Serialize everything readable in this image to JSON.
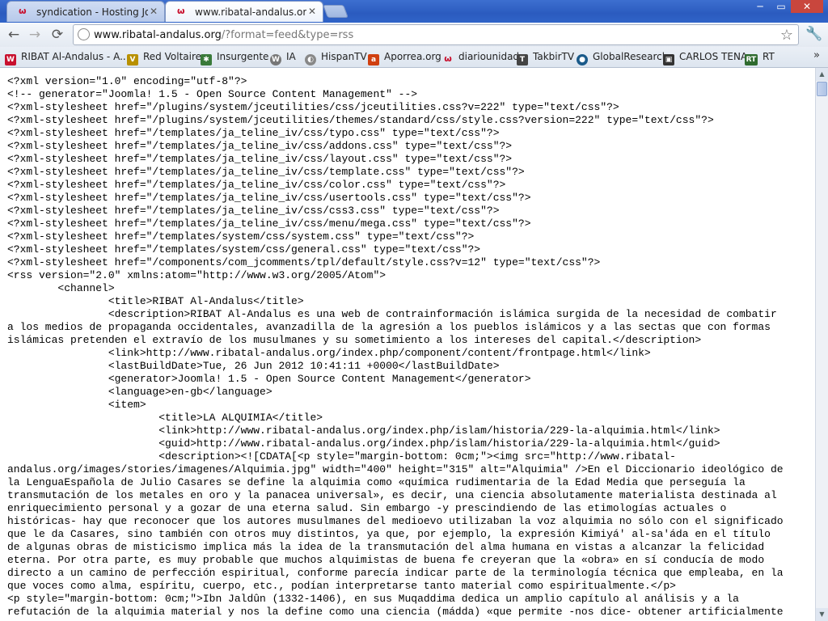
{
  "tabs": [
    {
      "label": "syndication - Hosting Joomla",
      "active": false
    },
    {
      "label": "www.ribatal-andalus.org/?forr",
      "active": true
    }
  ],
  "window_controls": {
    "minimize": "─",
    "maximize": "▭",
    "close": "✕"
  },
  "toolbar": {
    "back": "←",
    "forward": "→",
    "reload": "⟳"
  },
  "omnibox": {
    "host": "www.ribatal-andalus.org",
    "rest": "/?format=feed&type=rss"
  },
  "bookmarks": [
    {
      "label": "RIBAT Al-Andalus - A...",
      "icon": "ribat-icon",
      "color": "#c8102e"
    },
    {
      "label": "Red Voltaire",
      "icon": "voltaire-icon",
      "color": "#b89000"
    },
    {
      "label": "Insurgente",
      "icon": "insurgente-icon",
      "color": "#3a7a3a"
    },
    {
      "label": "IA",
      "icon": "wordpress-icon",
      "color": "#777777"
    },
    {
      "label": "HispanTV",
      "icon": "hispantv-icon",
      "color": "#888888"
    },
    {
      "label": "Aporrea.org",
      "icon": "aporrea-icon",
      "color": "#d04010"
    },
    {
      "label": "diariounidad",
      "icon": "diariounidad-icon",
      "color": "#c8102e"
    },
    {
      "label": "TakbirTV",
      "icon": "takbirtv-icon",
      "color": "#444444"
    },
    {
      "label": "GlobalResearch",
      "icon": "globalresearch-icon",
      "color": "#1a5a8a"
    },
    {
      "label": "CARLOS TENA",
      "icon": "carlostena-icon",
      "color": "#333333"
    },
    {
      "label": "RT",
      "icon": "rt-icon",
      "color": "#2f6b2f"
    }
  ],
  "bookmarks_more": "»",
  "content_lines": [
    "<?xml version=\"1.0\" encoding=\"utf-8\"?>",
    "<!-- generator=\"Joomla! 1.5 - Open Source Content Management\" -->",
    "<?xml-stylesheet href=\"/plugins/system/jceutilities/css/jceutilities.css?v=222\" type=\"text/css\"?>",
    "<?xml-stylesheet href=\"/plugins/system/jceutilities/themes/standard/css/style.css?version=222\" type=\"text/css\"?>",
    "<?xml-stylesheet href=\"/templates/ja_teline_iv/css/typo.css\" type=\"text/css\"?>",
    "<?xml-stylesheet href=\"/templates/ja_teline_iv/css/addons.css\" type=\"text/css\"?>",
    "<?xml-stylesheet href=\"/templates/ja_teline_iv/css/layout.css\" type=\"text/css\"?>",
    "<?xml-stylesheet href=\"/templates/ja_teline_iv/css/template.css\" type=\"text/css\"?>",
    "<?xml-stylesheet href=\"/templates/ja_teline_iv/css/color.css\" type=\"text/css\"?>",
    "<?xml-stylesheet href=\"/templates/ja_teline_iv/css/usertools.css\" type=\"text/css\"?>",
    "<?xml-stylesheet href=\"/templates/ja_teline_iv/css/css3.css\" type=\"text/css\"?>",
    "<?xml-stylesheet href=\"/templates/ja_teline_iv/css/menu/mega.css\" type=\"text/css\"?>",
    "<?xml-stylesheet href=\"/templates/system/css/system.css\" type=\"text/css\"?>",
    "<?xml-stylesheet href=\"/templates/system/css/general.css\" type=\"text/css\"?>",
    "<?xml-stylesheet href=\"/components/com_jcomments/tpl/default/style.css?v=12\" type=\"text/css\"?>",
    "<rss version=\"2.0\" xmlns:atom=\"http://www.w3.org/2005/Atom\">",
    "        <channel>",
    "                <title>RIBAT Al-Andalus</title>",
    "                <description>RIBAT Al-Andalus es una web de contrainformación islámica surgida de la necesidad de combatir",
    "a los medios de propaganda occidentales, avanzadilla de la agresión a los pueblos islámicos y a las sectas que con formas",
    "islámicas pretenden el extravío de los musulmanes y su sometimiento a los intereses del capital.</description>",
    "                <link>http://www.ribatal-andalus.org/index.php/component/content/frontpage.html</link>",
    "                <lastBuildDate>Tue, 26 Jun 2012 10:41:11 +0000</lastBuildDate>",
    "                <generator>Joomla! 1.5 - Open Source Content Management</generator>",
    "                <language>en-gb</language>",
    "                <item>",
    "                        <title>LA ALQUIMIA</title>",
    "                        <link>http://www.ribatal-andalus.org/index.php/islam/historia/229-la-alquimia.html</link>",
    "                        <guid>http://www.ribatal-andalus.org/index.php/islam/historia/229-la-alquimia.html</guid>",
    "                        <description><![CDATA[<p style=\"margin-bottom: 0cm;\"><img src=\"http://www.ribatal-",
    "andalus.org/images/stories/imagenes/Alquimia.jpg\" width=\"400\" height=\"315\" alt=\"Alquimia\" />En el Diccionario ideológico de",
    "la LenguaEspañola de Julio Casares se define la alquimia como «química rudimentaria de la Edad Media que perseguía la",
    "transmutación de los metales en oro y la panacea universal», es decir, una ciencia absolutamente materialista destinada al",
    "enriquecimiento personal y a gozar de una eterna salud. Sin embargo -y prescindiendo de las etimologías actuales o",
    "históricas- hay que reconocer que los autores musulmanes del medioevo utilizaban la voz alquimia no sólo con el significado",
    "que le da Casares, sino también con otros muy distintos, ya que, por ejemplo, la expresión Kimiyá' al-sa'áda en el título",
    "de algunas obras de misticismo implica más la idea de la transmutación del alma humana en vistas a alcanzar la felicidad",
    "eterna. Por otra parte, es muy probable que muchos alquimistas de buena fe creyeran que la «obra» en sí conducía de modo",
    "directo a un camino de perfección espiritual, conforme parecía indicar parte de la terminología técnica que empleaba, en la",
    "que voces como alma, espíritu, cuerpo, etc., podían interpretarse tanto material como espiritualmente.</p>",
    "<p style=\"margin-bottom: 0cm;\">Ibn Jaldûn (1332-1406), en sus Muqaddima dedica un amplio capítulo al análisis y a la",
    "refutación de la alquimia material y nos la define como una ciencia (mádda) «que permite -nos dice- obtener artificialmente"
  ]
}
